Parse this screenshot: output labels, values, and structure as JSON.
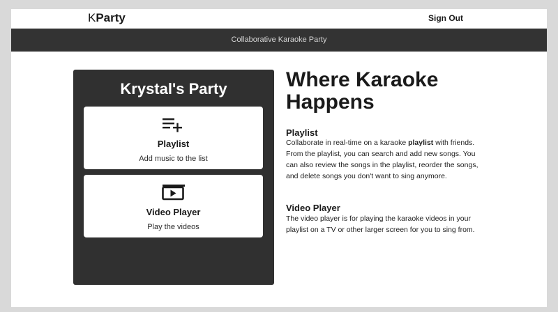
{
  "nav": {
    "brand_k": "K",
    "brand_rest": "Party",
    "sign_out": "Sign Out"
  },
  "subheader": {
    "text": "Collaborative Karaoke Party"
  },
  "party": {
    "title": "Krystal's Party",
    "cards": [
      {
        "icon": "playlist-add-icon",
        "title": "Playlist",
        "subtitle": "Add music to the list"
      },
      {
        "icon": "video-player-icon",
        "title": "Video Player",
        "subtitle": "Play the videos"
      }
    ]
  },
  "info": {
    "title": "Where Karaoke Happens",
    "sections": [
      {
        "heading": "Playlist",
        "body_before": "Collaborate in real-time on a karaoke ",
        "body_bold": "playlist",
        "body_after": " with friends. From the playlist, you can search and add new songs. You can also review the songs in the playlist, reorder the songs, and delete songs you don't want to sing anymore."
      },
      {
        "heading": "Video Player",
        "body": "The video player is for playing the karaoke videos in your playlist on a TV or other larger screen for you to sing from."
      }
    ]
  }
}
